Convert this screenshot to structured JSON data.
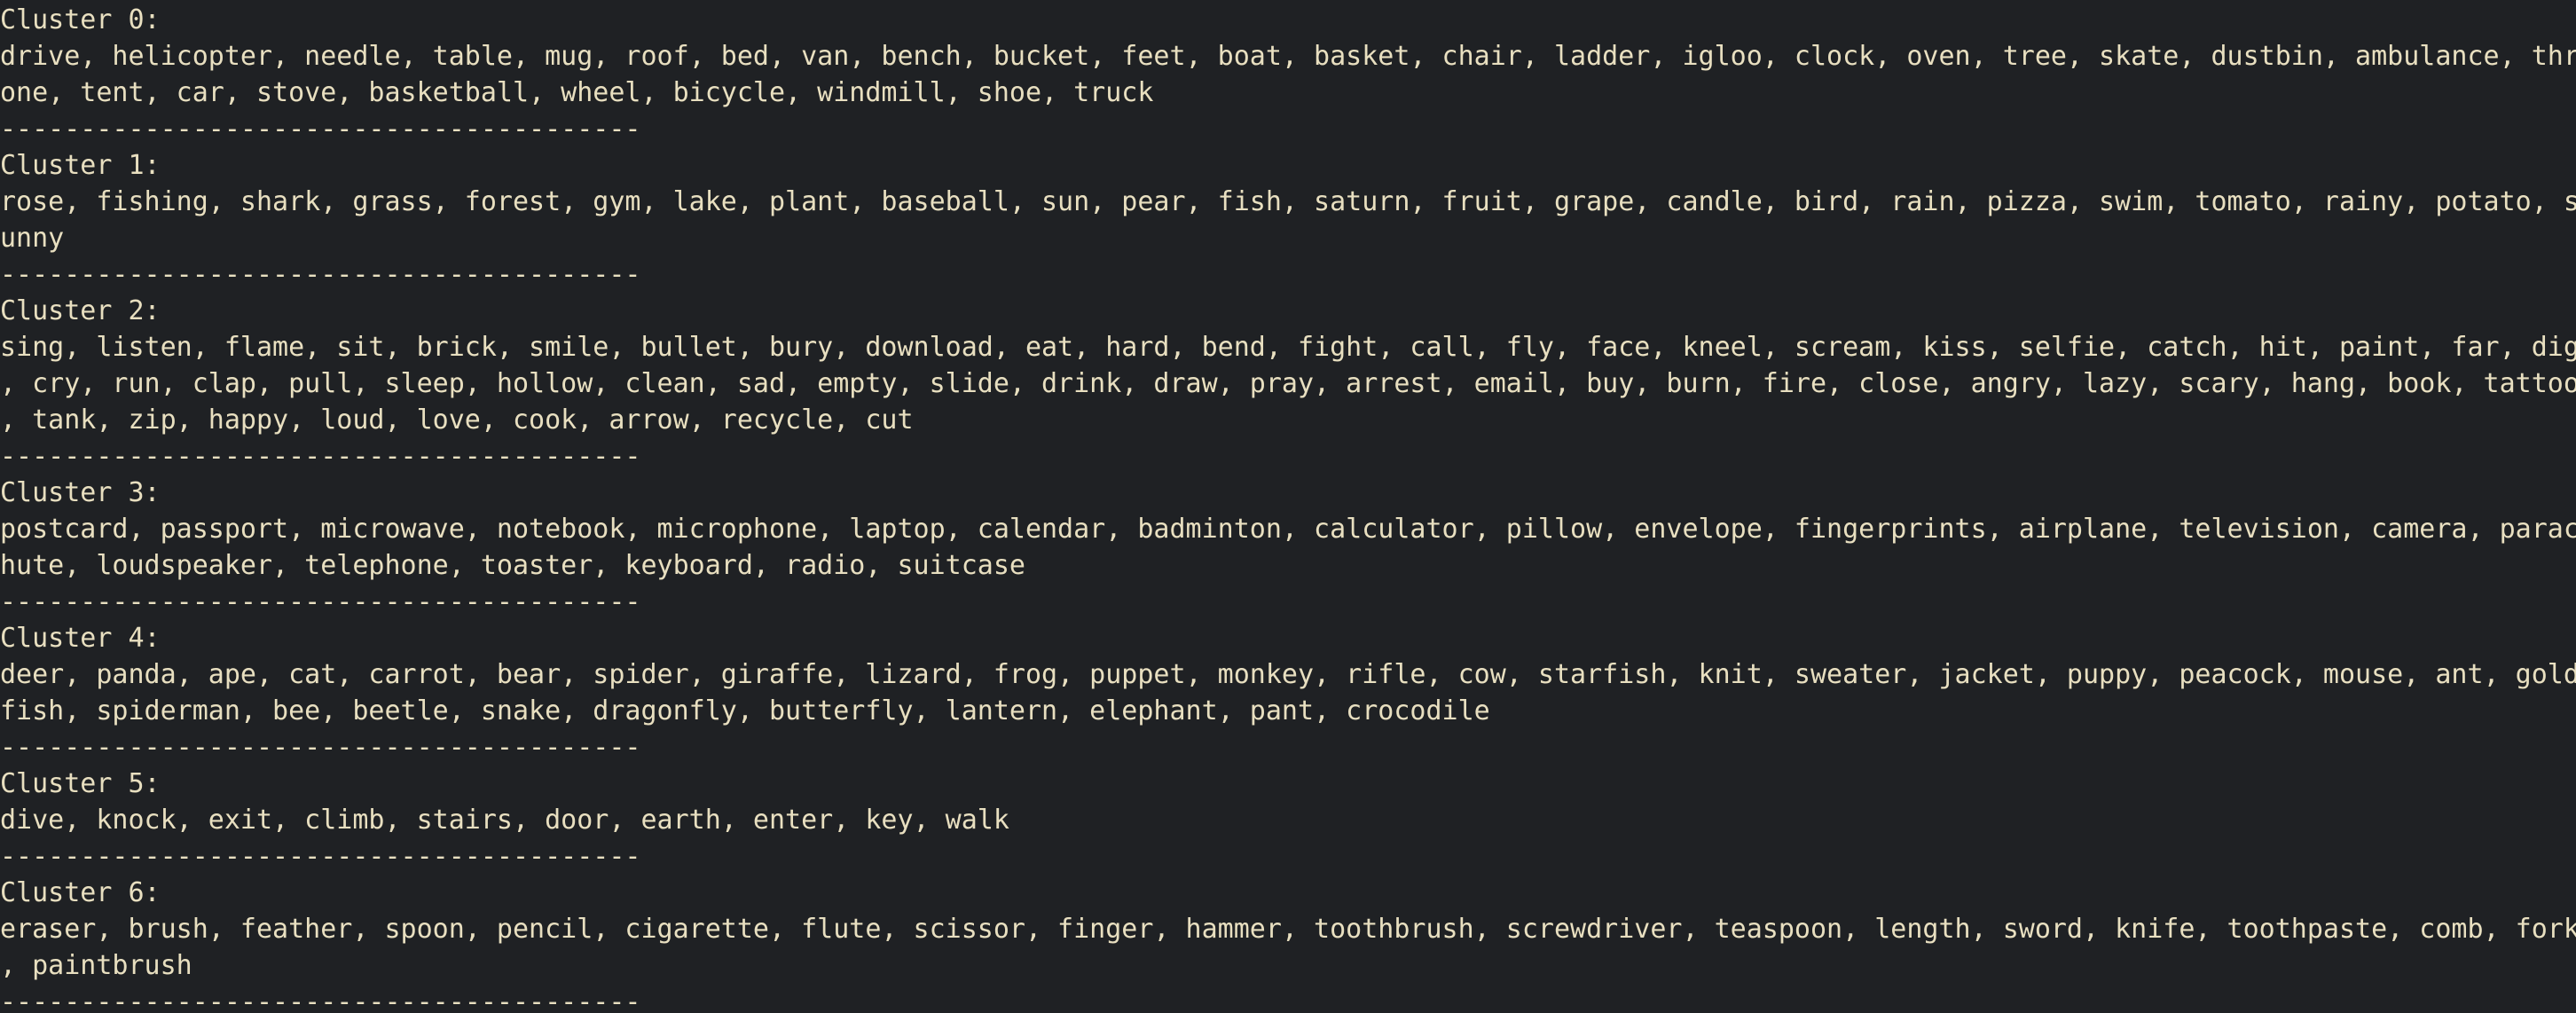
{
  "terminal_output": {
    "lines": [
      "Cluster 0:",
      "drive, helicopter, needle, table, mug, roof, bed, van, bench, bucket, feet, boat, basket, chair, ladder, igloo, clock, oven, tree, skate, dustbin, ambulance, thr",
      "one, tent, car, stove, basketball, wheel, bicycle, windmill, shoe, truck",
      "----------------------------------------",
      "Cluster 1:",
      "rose, fishing, shark, grass, forest, gym, lake, plant, baseball, sun, pear, fish, saturn, fruit, grape, candle, bird, rain, pizza, swim, tomato, rainy, potato, s",
      "unny",
      "----------------------------------------",
      "Cluster 2:",
      "sing, listen, flame, sit, brick, smile, bullet, bury, download, eat, hard, bend, fight, call, fly, face, kneel, scream, kiss, selfie, catch, hit, paint, far, dig",
      ", cry, run, clap, pull, sleep, hollow, clean, sad, empty, slide, drink, draw, pray, arrest, email, buy, burn, fire, close, angry, lazy, scary, hang, book, tattoo",
      ", tank, zip, happy, loud, love, cook, arrow, recycle, cut",
      "----------------------------------------",
      "Cluster 3:",
      "postcard, passport, microwave, notebook, microphone, laptop, calendar, badminton, calculator, pillow, envelope, fingerprints, airplane, television, camera, parac",
      "hute, loudspeaker, telephone, toaster, keyboard, radio, suitcase",
      "----------------------------------------",
      "Cluster 4:",
      "deer, panda, ape, cat, carrot, bear, spider, giraffe, lizard, frog, puppet, monkey, rifle, cow, starfish, knit, sweater, jacket, puppy, peacock, mouse, ant, gold",
      "fish, spiderman, bee, beetle, snake, dragonfly, butterfly, lantern, elephant, pant, crocodile",
      "----------------------------------------",
      "Cluster 5:",
      "dive, knock, exit, climb, stairs, door, earth, enter, key, walk",
      "----------------------------------------",
      "Cluster 6:",
      "eraser, brush, feather, spoon, pencil, cigarette, flute, scissor, finger, hammer, toothbrush, screwdriver, teaspoon, length, sword, knife, toothpaste, comb, fork",
      ", paintbrush",
      "----------------------------------------"
    ]
  },
  "colors": {
    "background": "#1f2124",
    "text": "#e8dfc0"
  }
}
